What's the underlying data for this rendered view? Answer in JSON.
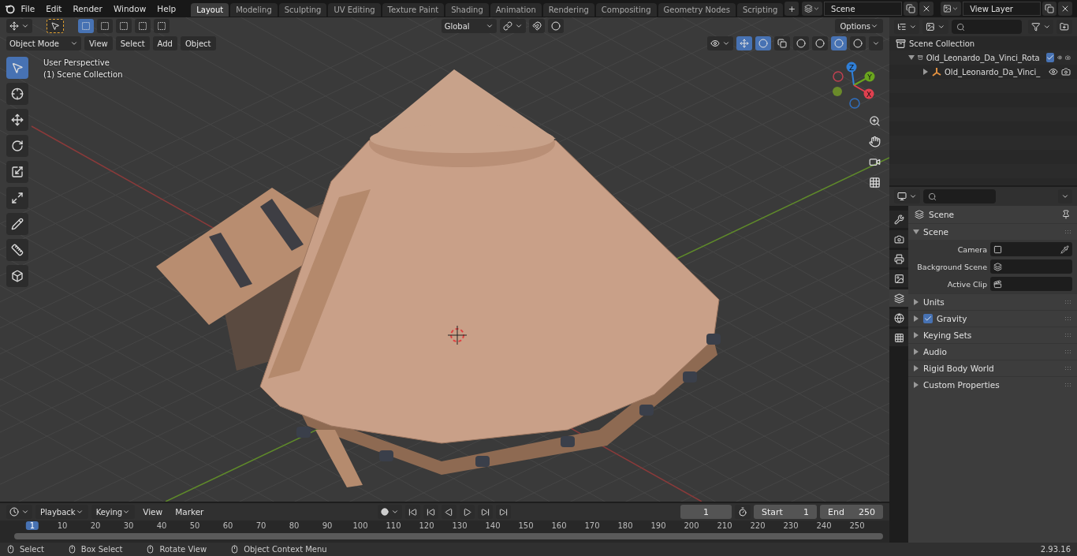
{
  "menu": [
    "File",
    "Edit",
    "Render",
    "Window",
    "Help"
  ],
  "workspaces": [
    {
      "label": "Layout",
      "selected": true
    },
    {
      "label": "Modeling",
      "selected": false
    },
    {
      "label": "Sculpting",
      "selected": false
    },
    {
      "label": "UV Editing",
      "selected": false
    },
    {
      "label": "Texture Paint",
      "selected": false
    },
    {
      "label": "Shading",
      "selected": false
    },
    {
      "label": "Animation",
      "selected": false
    },
    {
      "label": "Rendering",
      "selected": false
    },
    {
      "label": "Compositing",
      "selected": false
    },
    {
      "label": "Geometry Nodes",
      "selected": false
    },
    {
      "label": "Scripting",
      "selected": false
    }
  ],
  "add_workspace": "+",
  "scene": {
    "value": "Scene"
  },
  "view_layer": {
    "value": "View Layer"
  },
  "viewport": {
    "select_modes": [
      {
        "selected": true
      },
      {
        "selected": false
      },
      {
        "selected": false
      },
      {
        "selected": false
      },
      {
        "selected": false
      }
    ],
    "transform_orientation": "Global",
    "options": "Options",
    "mode": "Object Mode",
    "menus": [
      "View",
      "Select",
      "Add",
      "Object"
    ],
    "shading_modes": [
      {
        "selected": false
      },
      {
        "selected": false
      },
      {
        "selected": true
      },
      {
        "selected": false
      }
    ],
    "overlay_lines": [
      "User Perspective",
      "(1) Scene Collection"
    ],
    "tools": [
      {
        "kind": "select",
        "selected": true
      },
      {
        "kind": "cursor",
        "selected": false
      },
      {
        "kind": "move",
        "selected": false
      },
      {
        "kind": "rotate",
        "selected": false
      },
      {
        "kind": "scale",
        "selected": false
      },
      {
        "kind": "transform",
        "selected": false
      },
      {
        "kind": "annotate",
        "selected": false
      },
      {
        "kind": "measure",
        "selected": false
      },
      {
        "kind": "add_cube",
        "selected": false
      }
    ],
    "gizmo_axes": [
      {
        "label": "Z",
        "color": "#2f7fd8"
      },
      {
        "label": "Y",
        "color": "#6aa51e"
      },
      {
        "label": "X",
        "color": "#e0404f"
      }
    ]
  },
  "outliner": {
    "root": "Scene Collection",
    "items": [
      {
        "label": "Old_Leonardo_Da_Vinci_Rota",
        "kind": "collection",
        "expanded": true,
        "checked": true,
        "children": [
          {
            "label": "Old_Leonardo_Da_Vinci_",
            "kind": "object",
            "expanded": false
          }
        ]
      }
    ]
  },
  "properties": {
    "tabs": [
      {
        "kind": "tool",
        "selected": false
      },
      {
        "kind": "render",
        "selected": false
      },
      {
        "kind": "output",
        "selected": false
      },
      {
        "kind": "view_layer",
        "selected": false
      },
      {
        "kind": "scene",
        "selected": true
      },
      {
        "kind": "world",
        "selected": false
      },
      {
        "kind": "texture",
        "selected": false
      }
    ],
    "context": "Scene",
    "panels": [
      {
        "label": "Scene",
        "expanded": true,
        "fields": [
          {
            "label": "Camera",
            "kind": "camera"
          },
          {
            "label": "Background Scene",
            "kind": "scene"
          },
          {
            "label": "Active Clip",
            "kind": "clip"
          }
        ]
      },
      {
        "label": "Units",
        "expanded": false
      },
      {
        "label": "Gravity",
        "expanded": false,
        "checked": true
      },
      {
        "label": "Keying Sets",
        "expanded": false
      },
      {
        "label": "Audio",
        "expanded": false
      },
      {
        "label": "Rigid Body World",
        "expanded": false
      },
      {
        "label": "Custom Properties",
        "expanded": false
      }
    ]
  },
  "timeline": {
    "menus": [
      {
        "label": "Playback",
        "dropdown": true
      },
      {
        "label": "Keying",
        "dropdown": true
      },
      {
        "label": "View",
        "dropdown": false
      },
      {
        "label": "Marker",
        "dropdown": false
      }
    ],
    "current_frame": "1",
    "start": {
      "label": "Start",
      "value": "1"
    },
    "end": {
      "label": "End",
      "value": "250"
    },
    "ruler": [
      "1",
      "10",
      "20",
      "30",
      "40",
      "50",
      "60",
      "70",
      "80",
      "90",
      "100",
      "110",
      "120",
      "130",
      "140",
      "150",
      "160",
      "170",
      "180",
      "190",
      "200",
      "210",
      "220",
      "230",
      "240",
      "250"
    ]
  },
  "status_bar": {
    "hints": [
      "Select",
      "Box Select",
      "Rotate View",
      "Object Context Menu"
    ],
    "version": "2.93.16"
  }
}
